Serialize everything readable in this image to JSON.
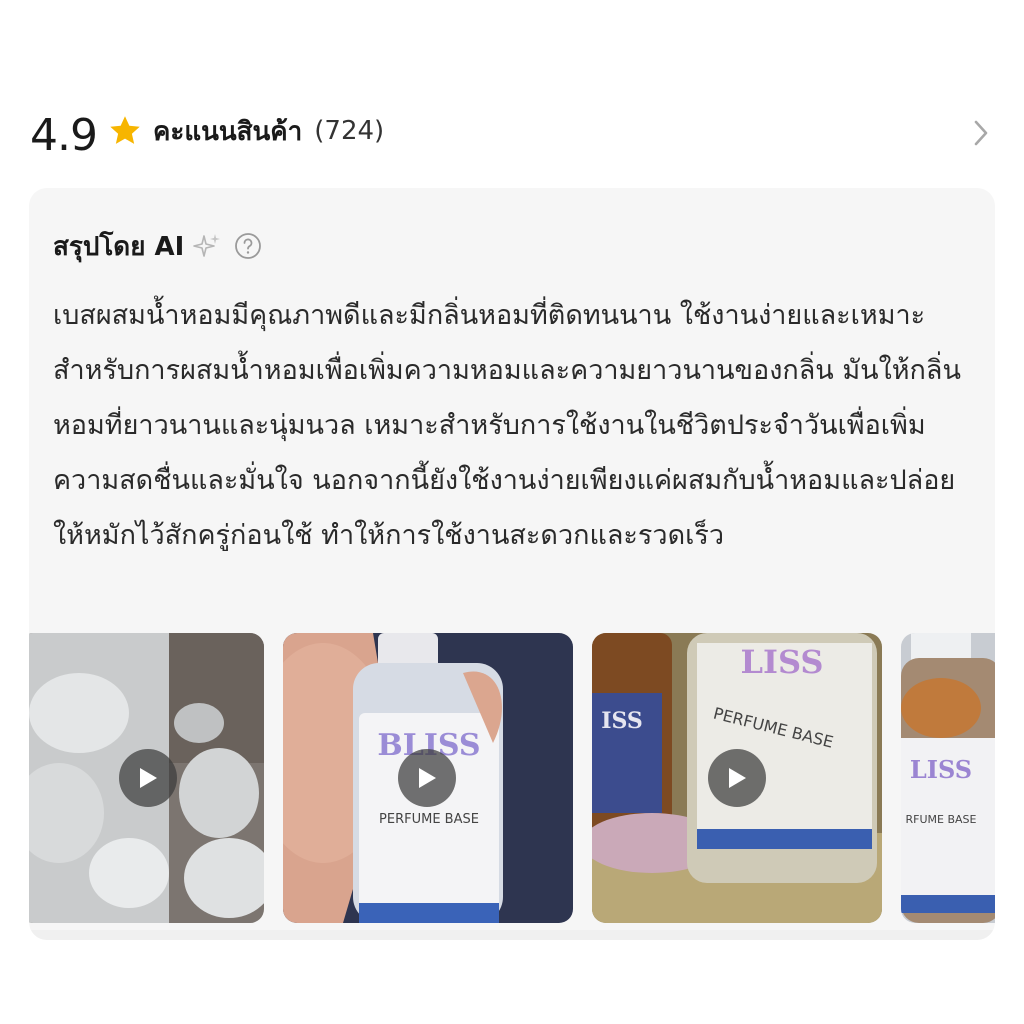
{
  "rating": {
    "score": "4.9",
    "label": "คะแนนสินค้า",
    "count": "(724)",
    "star_color": "#f7b500"
  },
  "ai_summary": {
    "title": "สรุปโดย AI",
    "text": "เบสผสมน้ำหอมมีคุณภาพดีและมีกลิ่นหอมที่ติดทนนาน ใช้งานง่ายและเหมาะสำหรับการผสมน้ำหอมเพื่อเพิ่มความหอมและความยาวนานของกลิ่น มันให้กลิ่นหอมที่ยาวนานและนุ่มนวล เหมาะสำหรับการใช้งานในชีวิตประจำวันเพื่อเพิ่มความสดชื่นและมั่นใจ นอกจากนี้ยังใช้งานง่ายเพียงแค่ผสมกับน้ำหอมและปล่อยให้หมักไว้สักครู่ก่อนใช้ ทำให้การใช้งานสะดวกและรวดเร็ว",
    "icons": [
      "sparkle-icon",
      "help-icon"
    ]
  },
  "media": {
    "videos": [
      {
        "kind": "video",
        "label": ""
      },
      {
        "kind": "video",
        "label": "BLISS PERFUME BASE"
      },
      {
        "kind": "video",
        "label": "PERFUME BASE"
      },
      {
        "kind": "video",
        "label": "BLISS PERFUME BASE"
      }
    ]
  }
}
